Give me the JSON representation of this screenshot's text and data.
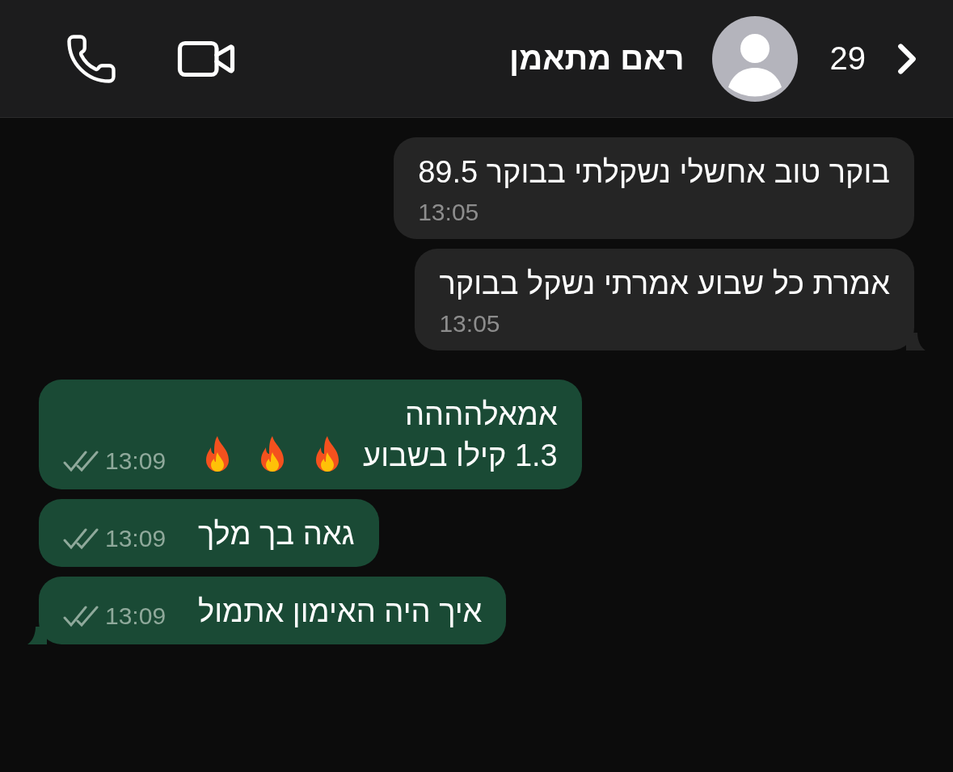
{
  "header": {
    "contact_name": "ראם מתאמן",
    "unread_count": "29"
  },
  "messages": [
    {
      "kind": "incoming",
      "lines": [
        "בוקר טוב אחשלי נשקלתי בבוקר 89.5"
      ],
      "time": "13:05",
      "tail": false
    },
    {
      "kind": "incoming",
      "lines": [
        "אמרת כל שבוע אמרתי נשקל בבוקר"
      ],
      "time": "13:05",
      "tail": true
    },
    {
      "kind": "outgoing",
      "lines": [
        "אמאלהההה",
        "1.3 קילו בשבוע"
      ],
      "icons": [
        {
          "kind": "fire"
        },
        {
          "kind": "fire"
        },
        {
          "kind": "fire"
        }
      ],
      "time": "13:09",
      "read": false,
      "tail": false
    },
    {
      "kind": "outgoing",
      "lines": [
        "גאה בך מלך"
      ],
      "time": "13:09",
      "read": false,
      "tail": false
    },
    {
      "kind": "outgoing",
      "lines": [
        "איך היה האימון אתמול"
      ],
      "time": "13:09",
      "read": false,
      "tail": true
    }
  ]
}
